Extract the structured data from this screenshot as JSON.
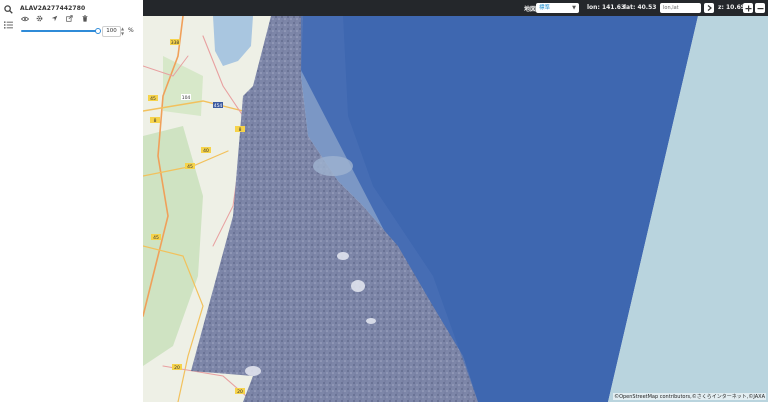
{
  "panel": {
    "layer_name": "ALAV2A277442780",
    "opacity_value": "100",
    "opacity_unit": "%",
    "opacity_fraction": 1.0,
    "tools": [
      "eye-icon",
      "gear-icon",
      "locate-icon",
      "export-icon",
      "trash-icon"
    ]
  },
  "topbar": {
    "dataset_label": "地図",
    "dataset_value": "標準",
    "lon_label": "lon: 141.63",
    "lat_label": "lat: 40.53",
    "location_placeholder": "lon,lat",
    "zoom_label": "z: 10.69"
  },
  "map": {
    "attribution": "©OpenStreetMap contributors,©さくらインターネット,©JAXA",
    "road_labels": [
      "338",
      "45",
      "104",
      "454",
      "8",
      "8",
      "40",
      "45",
      "45",
      "20",
      "20"
    ],
    "colors": {
      "sea": "#3e67b0",
      "land": "#eef0e6",
      "scene_edge": "#b9d4de",
      "topbar": "#24272b",
      "accent": "#2f8bd8"
    }
  }
}
